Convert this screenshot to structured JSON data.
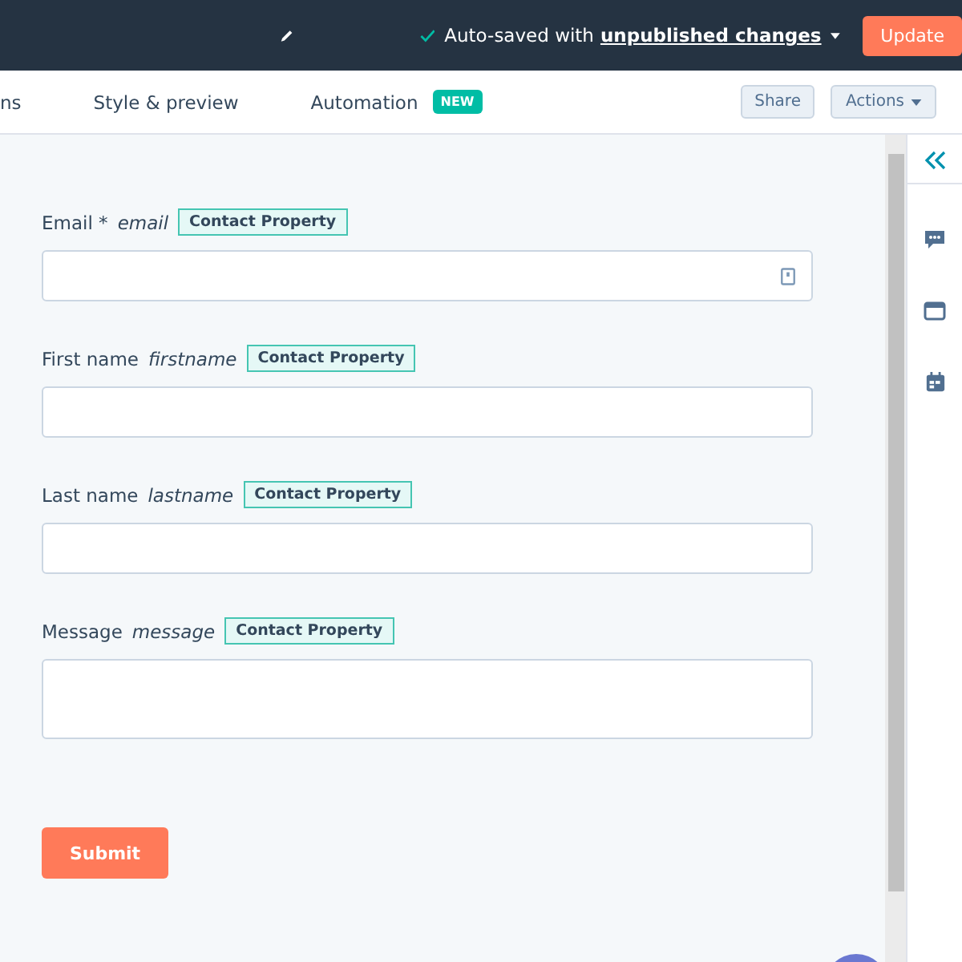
{
  "top_bar": {
    "status_prefix": "Auto-saved with",
    "status_link": "unpublished changes",
    "update_button": "Update"
  },
  "tabs": [
    {
      "label": "ns"
    },
    {
      "label": "Style & preview"
    },
    {
      "label": "Automation",
      "badge": "NEW"
    }
  ],
  "actions": {
    "share": "Share",
    "actions": "Actions"
  },
  "fields": [
    {
      "label": "Email *",
      "name": "email",
      "badge": "Contact Property",
      "icon": true,
      "tall": false
    },
    {
      "label": "First name",
      "name": "firstname",
      "badge": "Contact Property",
      "icon": false,
      "tall": false
    },
    {
      "label": "Last name",
      "name": "lastname",
      "badge": "Contact Property",
      "icon": false,
      "tall": false
    },
    {
      "label": "Message",
      "name": "message",
      "badge": "Contact Property",
      "icon": false,
      "tall": true
    }
  ],
  "submit": "Submit"
}
